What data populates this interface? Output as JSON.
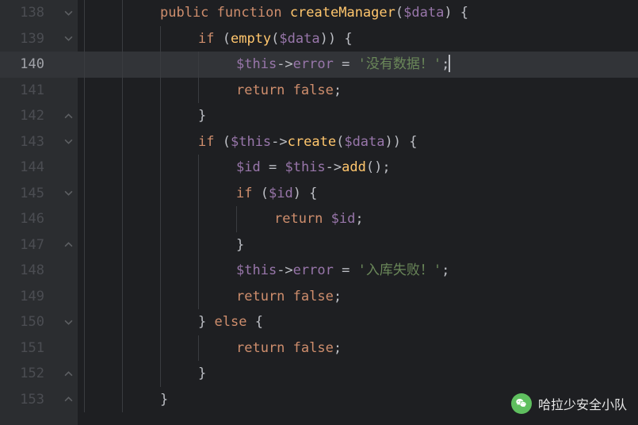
{
  "startLine": 138,
  "highlightLine": 140,
  "watermark": "哈拉少安全小队",
  "lines": [
    {
      "n": 138,
      "fold": "down",
      "indent": 2,
      "tokens": [
        [
          "kw",
          "public"
        ],
        [
          "plain",
          " "
        ],
        [
          "kw",
          "function"
        ],
        [
          "plain",
          " "
        ],
        [
          "fn",
          "createManager"
        ],
        [
          "op",
          "("
        ],
        [
          "var",
          "$data"
        ],
        [
          "op",
          ") {"
        ]
      ]
    },
    {
      "n": 139,
      "fold": "down",
      "indent": 3,
      "tokens": [
        [
          "kw",
          "if"
        ],
        [
          "plain",
          " "
        ],
        [
          "op",
          "("
        ],
        [
          "fn",
          "empty"
        ],
        [
          "op",
          "("
        ],
        [
          "var",
          "$data"
        ],
        [
          "op",
          ")) {"
        ]
      ]
    },
    {
      "n": 140,
      "fold": null,
      "indent": 4,
      "tokens": [
        [
          "var",
          "$this"
        ],
        [
          "arr",
          "->"
        ],
        [
          "var",
          "error"
        ],
        [
          "plain",
          " "
        ],
        [
          "op",
          "="
        ],
        [
          "plain",
          " "
        ],
        [
          "str",
          "'没有数据！'"
        ],
        [
          "op",
          ";"
        ]
      ],
      "cursor": true
    },
    {
      "n": 141,
      "fold": null,
      "indent": 4,
      "tokens": [
        [
          "kw",
          "return"
        ],
        [
          "plain",
          " "
        ],
        [
          "const",
          "false"
        ],
        [
          "op",
          ";"
        ]
      ]
    },
    {
      "n": 142,
      "fold": "up",
      "indent": 3,
      "tokens": [
        [
          "op",
          "}"
        ]
      ]
    },
    {
      "n": 143,
      "fold": "down",
      "indent": 3,
      "tokens": [
        [
          "kw",
          "if"
        ],
        [
          "plain",
          " "
        ],
        [
          "op",
          "("
        ],
        [
          "var",
          "$this"
        ],
        [
          "arr",
          "->"
        ],
        [
          "fn",
          "create"
        ],
        [
          "op",
          "("
        ],
        [
          "var",
          "$data"
        ],
        [
          "op",
          ")) {"
        ]
      ]
    },
    {
      "n": 144,
      "fold": null,
      "indent": 4,
      "tokens": [
        [
          "var",
          "$id"
        ],
        [
          "plain",
          " "
        ],
        [
          "op",
          "="
        ],
        [
          "plain",
          " "
        ],
        [
          "var",
          "$this"
        ],
        [
          "arr",
          "->"
        ],
        [
          "fn",
          "add"
        ],
        [
          "op",
          "();"
        ]
      ]
    },
    {
      "n": 145,
      "fold": "down",
      "indent": 4,
      "tokens": [
        [
          "kw",
          "if"
        ],
        [
          "plain",
          " "
        ],
        [
          "op",
          "("
        ],
        [
          "var",
          "$id"
        ],
        [
          "op",
          ") {"
        ]
      ]
    },
    {
      "n": 146,
      "fold": null,
      "indent": 5,
      "tokens": [
        [
          "kw",
          "return"
        ],
        [
          "plain",
          " "
        ],
        [
          "var",
          "$id"
        ],
        [
          "op",
          ";"
        ]
      ]
    },
    {
      "n": 147,
      "fold": "up",
      "indent": 4,
      "tokens": [
        [
          "op",
          "}"
        ]
      ]
    },
    {
      "n": 148,
      "fold": null,
      "indent": 4,
      "tokens": [
        [
          "var",
          "$this"
        ],
        [
          "arr",
          "->"
        ],
        [
          "var",
          "error"
        ],
        [
          "plain",
          " "
        ],
        [
          "op",
          "="
        ],
        [
          "plain",
          " "
        ],
        [
          "str",
          "'入库失败！'"
        ],
        [
          "op",
          ";"
        ]
      ]
    },
    {
      "n": 149,
      "fold": null,
      "indent": 4,
      "tokens": [
        [
          "kw",
          "return"
        ],
        [
          "plain",
          " "
        ],
        [
          "const",
          "false"
        ],
        [
          "op",
          ";"
        ]
      ]
    },
    {
      "n": 150,
      "fold": "down",
      "indent": 3,
      "tokens": [
        [
          "op",
          "}"
        ],
        [
          "plain",
          " "
        ],
        [
          "kw",
          "else"
        ],
        [
          "plain",
          " "
        ],
        [
          "op",
          "{"
        ]
      ]
    },
    {
      "n": 151,
      "fold": null,
      "indent": 4,
      "tokens": [
        [
          "kw",
          "return"
        ],
        [
          "plain",
          " "
        ],
        [
          "const",
          "false"
        ],
        [
          "op",
          ";"
        ]
      ]
    },
    {
      "n": 152,
      "fold": "up",
      "indent": 3,
      "tokens": [
        [
          "op",
          "}"
        ]
      ]
    },
    {
      "n": 153,
      "fold": "up",
      "indent": 2,
      "tokens": [
        [
          "op",
          "}"
        ]
      ]
    }
  ]
}
